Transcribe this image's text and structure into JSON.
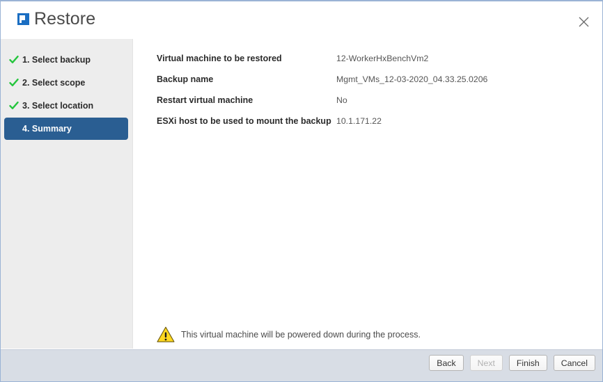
{
  "window": {
    "title": "Restore",
    "logo_icon": "app-logo-icon",
    "close_icon": "close-icon"
  },
  "sidebar": {
    "steps": [
      {
        "label": "1. Select backup",
        "completed": true,
        "active": false
      },
      {
        "label": "2. Select scope",
        "completed": true,
        "active": false
      },
      {
        "label": "3. Select location",
        "completed": true,
        "active": false
      },
      {
        "label": "4. Summary",
        "completed": false,
        "active": true
      }
    ],
    "check_icon": "check-icon"
  },
  "main": {
    "rows": [
      {
        "label": "Virtual machine to be restored",
        "value": "12-WorkerHxBenchVm2"
      },
      {
        "label": "Backup name",
        "value": "Mgmt_VMs_12-03-2020_04.33.25.0206"
      },
      {
        "label": "Restart virtual machine",
        "value": "No"
      },
      {
        "label": "ESXi host to be used to mount the backup",
        "value": "10.1.171.22"
      }
    ],
    "notice": {
      "icon": "warning-triangle-icon",
      "text": "This virtual machine will be powered down during the process."
    }
  },
  "footer": {
    "buttons": [
      {
        "label": "Back",
        "disabled": false
      },
      {
        "label": "Next",
        "disabled": true
      },
      {
        "label": "Finish",
        "disabled": false
      },
      {
        "label": "Cancel",
        "disabled": false
      }
    ]
  },
  "colors": {
    "accent_blue": "#2a5e92",
    "logo_blue": "#1b6ec2",
    "check_green": "#25c53d",
    "warning_yellow": "#ffd81f",
    "footer_bar": "#d8dde5",
    "sidebar_bg": "#ededed"
  }
}
